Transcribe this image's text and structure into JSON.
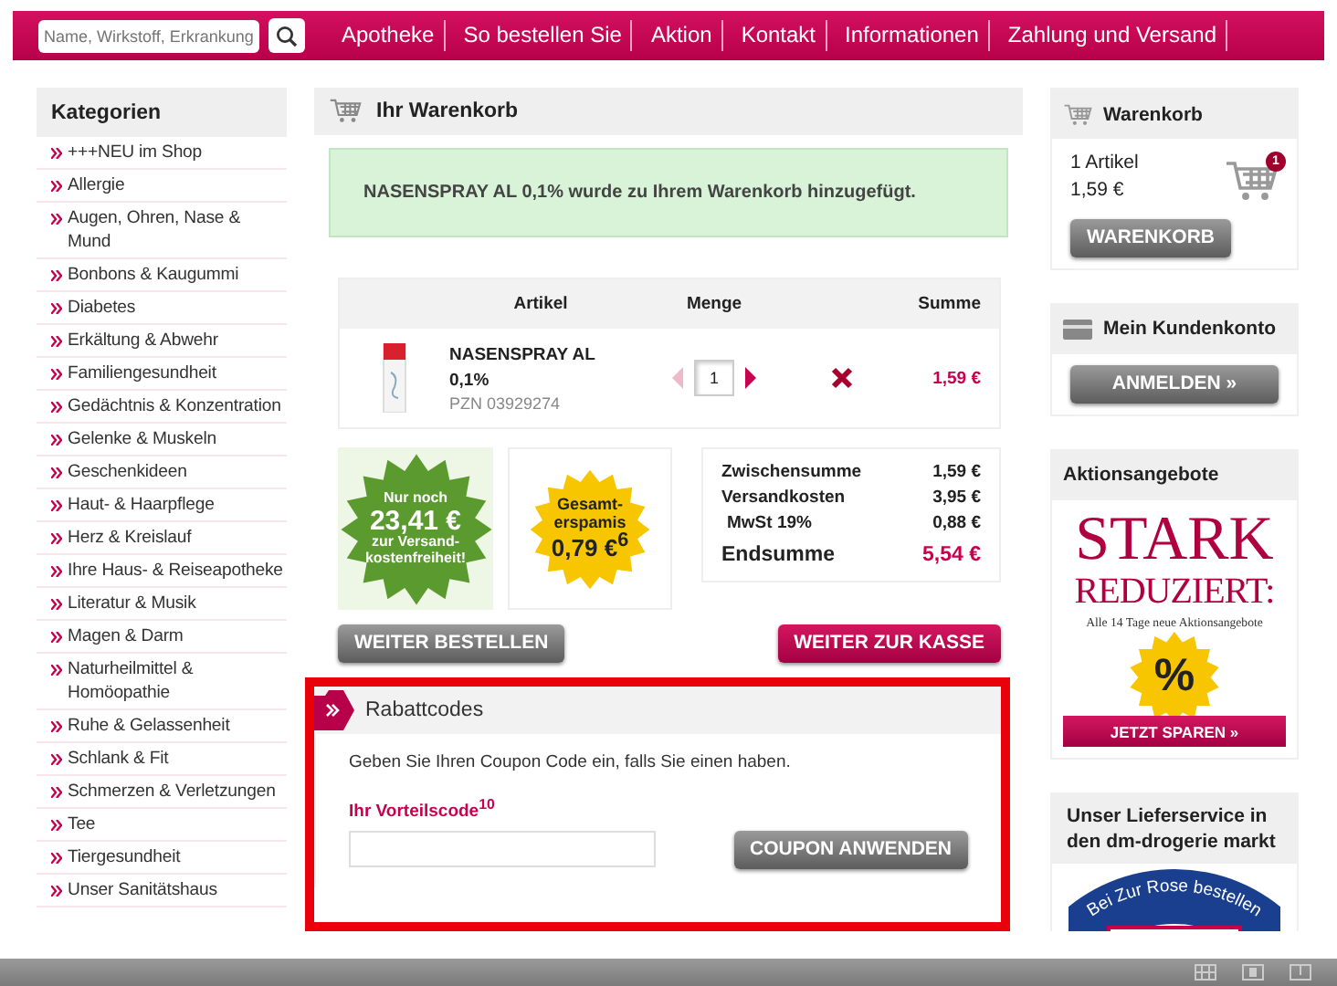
{
  "search": {
    "placeholder": "Name, Wirkstoff, Erkrankung"
  },
  "nav": [
    "Apotheke",
    "So bestellen Sie",
    "Aktion",
    "Kontakt",
    "Informationen",
    "Zahlung und Versand"
  ],
  "categories": {
    "title": "Kategorien",
    "items": [
      "+++NEU im Shop",
      "Allergie",
      "Augen, Ohren, Nase & Mund",
      "Bonbons & Kaugummi",
      "Diabetes",
      "Erkältung & Abwehr",
      "Familiengesundheit",
      "Gedächtnis & Konzentration",
      "Gelenke & Muskeln",
      "Geschenkideen",
      "Haut- & Haarpflege",
      "Herz & Kreislauf",
      "Ihre Haus- & Reiseapotheke",
      "Literatur & Musik",
      "Magen & Darm",
      "Naturheilmittel & Homöopathie",
      "Ruhe & Gelassenheit",
      "Schlank & Fit",
      "Schmerzen & Verletzungen",
      "Tee",
      "Tiergesundheit",
      "Unser Sanitätshaus"
    ]
  },
  "cart": {
    "title": "Ihr Warenkorb",
    "message": "NASENSPRAY AL 0,1% wurde zu Ihrem Warenkorb hinzugefügt.",
    "columns": [
      "Artikel",
      "Menge",
      "Summe"
    ],
    "items": [
      {
        "name": "NASENSPRAY AL 0,1%",
        "pzn": "PZN 03929274",
        "quantity": "1",
        "decrease_disabled": true,
        "sum": "1,59 €"
      }
    ],
    "shipping_badge": [
      "Nur noch",
      "23,41 €",
      "zur Versand-",
      "kostenfreiheit!"
    ],
    "savings_badge": [
      "Gesamt-",
      "erspamis",
      "0,79 €$^{6}$"
    ],
    "totals": [
      {
        "kind": "line",
        "label": "Zwischensumme",
        "value": "1,59 €"
      },
      {
        "kind": "line",
        "label": "Versandkosten",
        "value": "3,95 €"
      },
      {
        "kind": "tax",
        "label": "MwSt 19%",
        "value": "0,88 €"
      },
      {
        "kind": "total",
        "label": "Endsumme",
        "value": "5,54 €"
      }
    ],
    "continue_button": "WEITER BESTELLEN",
    "checkout_button": "WEITER ZUR KASSE"
  },
  "coupon": {
    "highlighted": true,
    "title": "Rabattcodes",
    "hint": "Geben Sie Ihren Coupon Code ein, falls Sie einen haben.",
    "label": "Ihr Vorteilscode$^{10}$",
    "button": "COUPON ANWENDEN"
  },
  "cart_widget": {
    "title": "Warenkorb",
    "count": "1 Artikel",
    "total": "1,59 €",
    "badge": "1",
    "button": "WARENKORB"
  },
  "account": {
    "title": "Mein Kundenkonto",
    "button": "ANMELDEN »"
  },
  "offers": {
    "title": "Aktionsangebote",
    "headline": "STARK",
    "subheadline": "REDUZIERT:",
    "note": "Alle 14 Tage neue Aktionsangebote",
    "badge": "%",
    "button": "JETZT SPAREN »"
  },
  "delivery": {
    "title": "Unser Lieferservice in den dm-drogerie markt",
    "logo_text": "Bei Zur Rose bestellen"
  }
}
